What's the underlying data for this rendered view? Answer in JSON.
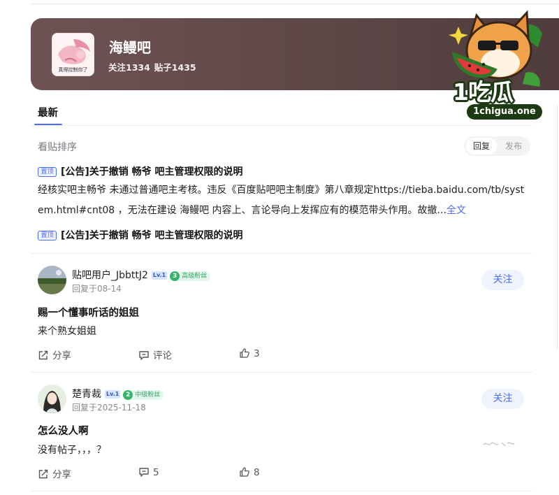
{
  "forum": {
    "name": "海鳗吧",
    "follow_count": "关注1334",
    "post_count": "贴子1435",
    "avatar_caption": "真得控制你了"
  },
  "watermark": {
    "brand": "1吃瓜",
    "url": "1chigua.one"
  },
  "tabs": {
    "latest": "最新"
  },
  "sort": {
    "label": "看贴排序",
    "reply": "回复",
    "publish": "发布"
  },
  "pinned": [
    {
      "badge": "置顶",
      "title": "[公告]关于撤销 畅爷 吧主管理权限的说明",
      "body": "经核实吧主畅爷 未通过普通吧主考核。违反《百度贴吧吧主制度》第八章规定https://tieba.baidu.com/tb/system.html#cnt08 ，无法在建设 海鳗吧 内容上、言论导向上发挥应有的模范带头作用。故撤...",
      "more": "全文"
    },
    {
      "badge": "置顶",
      "title": "[公告]关于撤销 畅爷 吧主管理权限的说明"
    }
  ],
  "posts": [
    {
      "username": "贴吧用户_JbbttJ2",
      "level": "Lv.1",
      "fan_level": "3",
      "fan_label": "高级粉丝",
      "time": "回复于08-14",
      "follow": "关注",
      "title": "赐一个懂事听话的姐姐",
      "text": "来个熟女姐姐",
      "share": "分享",
      "comment": "评论",
      "likes": "3"
    },
    {
      "username": "楚青裁",
      "level": "Lv.1",
      "fan_level": "2",
      "fan_label": "中级粉丝",
      "time": "回复于2025-11-18",
      "follow": "关注",
      "title": "怎么没人啊",
      "text": "没有帖子，，，？",
      "share": "分享",
      "comment": "5",
      "likes": "8"
    }
  ],
  "colors": {
    "accent": "#4e6ef2",
    "banner": "#5e4747",
    "fan_green": "#35b56c"
  }
}
